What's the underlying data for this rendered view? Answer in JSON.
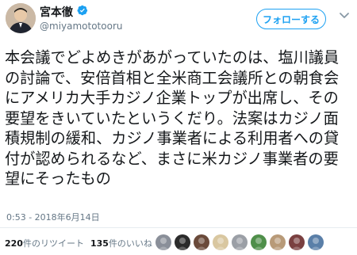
{
  "author": {
    "display_name": "宮本徹",
    "handle": "@miyamototooru"
  },
  "follow_button_label": "フォローする",
  "tweet": {
    "text": "本会議でどよめきがあがっていたのは、塩川議員の討論で、安倍首相と全米商工会議所との朝食会にアメリカ大手カジノ企業トップが出席し、その要望をきいていたというくだり。法案はカジノ面積規制の緩和、カジノ事業者による利用者への貸付が認められるなど、まさに米カジノ事業者の要望にそったもの",
    "timestamp": "0:53 - 2018年6月14日"
  },
  "stats": {
    "retweets_count": "220",
    "retweets_label": "件のリツイート",
    "likes_count": "135",
    "likes_label": "件のいいね"
  },
  "icons": {
    "verified": "verified-badge-icon",
    "chevron": "chevron-down-icon"
  },
  "colors": {
    "accent": "#1da1f2",
    "text": "#14171a",
    "muted": "#657786",
    "divider": "#e6ecf0"
  },
  "liker_avatars": [
    {
      "color": "#8a8f99"
    },
    {
      "color": "#2b2b2b"
    },
    {
      "color": "#6a4a3a"
    },
    {
      "color": "#d9c7a0"
    },
    {
      "color": "#9b9fa6"
    },
    {
      "color": "#4f8f4a"
    },
    {
      "color": "#b89a78"
    },
    {
      "color": "#7a4040"
    },
    {
      "color": "#5a7fa8"
    }
  ]
}
